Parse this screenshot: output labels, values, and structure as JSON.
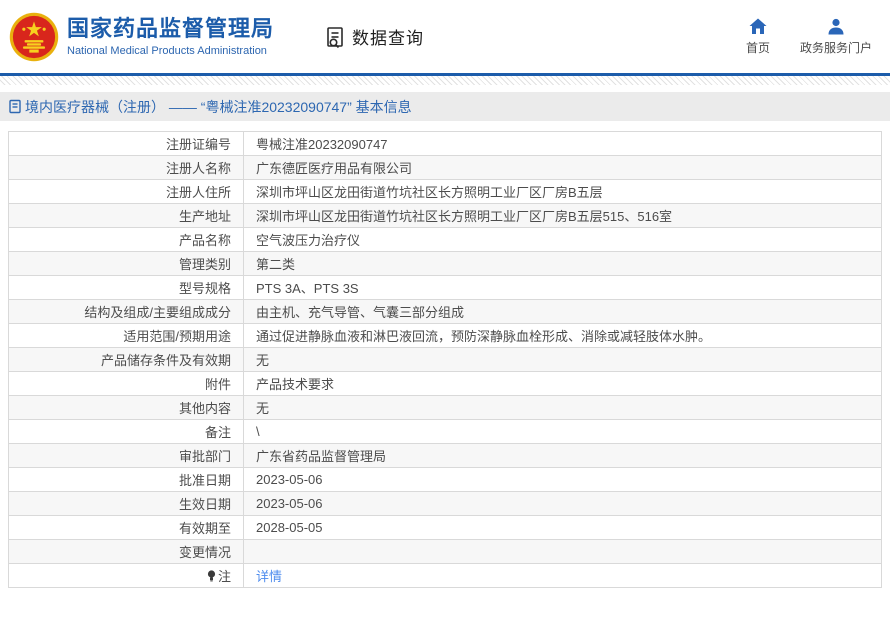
{
  "header": {
    "site_title": "国家药品监督管理局",
    "site_subtitle": "National Medical Products Administration",
    "section_label": "数据查询",
    "nav": [
      {
        "icon": "home-icon",
        "label": "首页"
      },
      {
        "icon": "user-icon",
        "label": "政务服务门户"
      }
    ]
  },
  "breadcrumb": {
    "text": "境内医疗器械（注册） —— “粤械注准20232090747” 基本信息"
  },
  "colors": {
    "brand_blue": "#1c5caa",
    "icon_blue": "#2a66b8",
    "link_blue": "#4e8cee",
    "breadcrumb_bg": "#ebebeb",
    "row_alt_bg": "#f7f7f7",
    "table_border": "#d9d9d9"
  },
  "table": {
    "rows": [
      {
        "label": "注册证编号",
        "value": "粤械注准20232090747"
      },
      {
        "label": "注册人名称",
        "value": "广东德匠医疗用品有限公司"
      },
      {
        "label": "注册人住所",
        "value": "深圳市坪山区龙田街道竹坑社区长方照明工业厂区厂房B五层"
      },
      {
        "label": "生产地址",
        "value": "深圳市坪山区龙田街道竹坑社区长方照明工业厂区厂房B五层515、516室"
      },
      {
        "label": "产品名称",
        "value": "空气波压力治疗仪"
      },
      {
        "label": "管理类别",
        "value": "第二类"
      },
      {
        "label": "型号规格",
        "value": "PTS 3A、PTS 3S"
      },
      {
        "label": "结构及组成/主要组成成分",
        "value": "由主机、充气导管、气囊三部分组成"
      },
      {
        "label": "适用范围/预期用途",
        "value": "通过促进静脉血液和淋巴液回流，预防深静脉血栓形成、消除或减轻肢体水肿。"
      },
      {
        "label": "产品储存条件及有效期",
        "value": "无"
      },
      {
        "label": "附件",
        "value": "产品技术要求"
      },
      {
        "label": "其他内容",
        "value": "无"
      },
      {
        "label": "备注",
        "value": "\\"
      },
      {
        "label": "审批部门",
        "value": "广东省药品监督管理局"
      },
      {
        "label": "批准日期",
        "value": "2023-05-06"
      },
      {
        "label": "生效日期",
        "value": "2023-05-06"
      },
      {
        "label": "有效期至",
        "value": "2028-05-05"
      },
      {
        "label": "变更情况",
        "value": ""
      },
      {
        "label": "注",
        "label_icon": "bulb-icon",
        "value": "详情",
        "value_is_link": true
      }
    ]
  }
}
